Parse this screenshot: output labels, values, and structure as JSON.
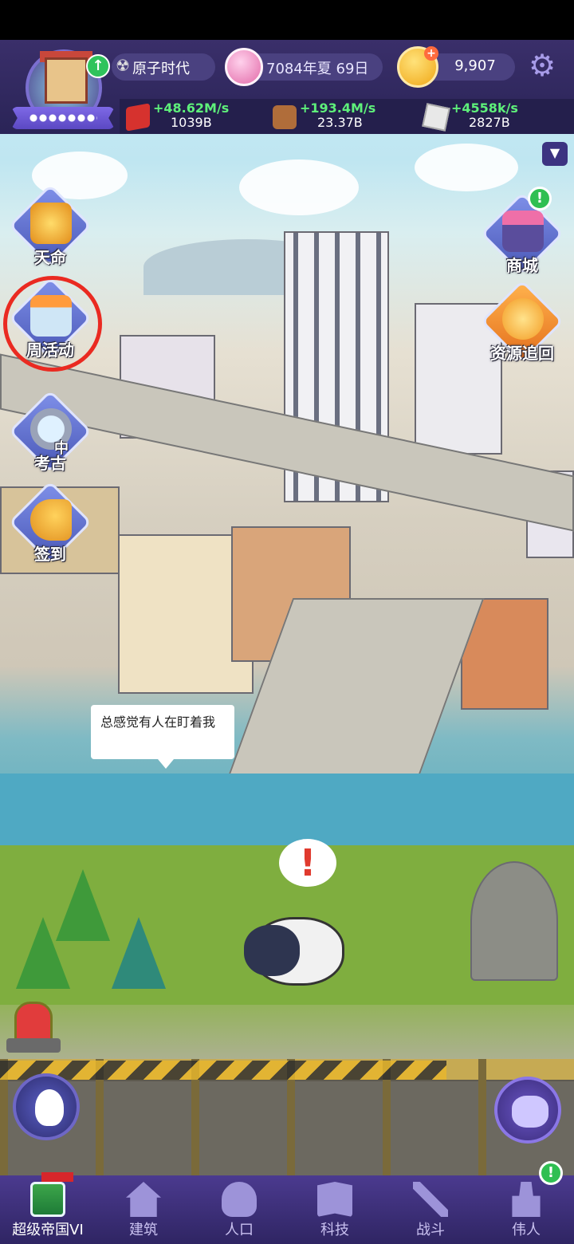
{
  "hud": {
    "era_label": "原子时代",
    "date_label": "7084年夏 69日",
    "coins": "9,907",
    "resources": [
      {
        "rate": "+48.62M/s",
        "amount": "1039B"
      },
      {
        "rate": "+193.4M/s",
        "amount": "23.37B"
      },
      {
        "rate": "+4558k/s",
        "amount": "2827B"
      }
    ]
  },
  "side_left": {
    "tianming": "天命",
    "weekly_event": "周活动",
    "archaeology": "考古",
    "archaeology_status": "中",
    "sign_in": "签到"
  },
  "side_right": {
    "shop": "商城",
    "resource_recover": "资源追回"
  },
  "speech": "总感觉有人在盯着我",
  "exclaim": "!",
  "alert_mark": "!",
  "bottom_nav": [
    {
      "label": "超级帝国VI"
    },
    {
      "label": "建筑"
    },
    {
      "label": "人口"
    },
    {
      "label": "科技"
    },
    {
      "label": "战斗"
    },
    {
      "label": "伟人"
    }
  ],
  "colors": {
    "hud_bg": "#2a2457",
    "highlight_circle": "#ea2a21",
    "rate_green": "#5ef07a"
  }
}
